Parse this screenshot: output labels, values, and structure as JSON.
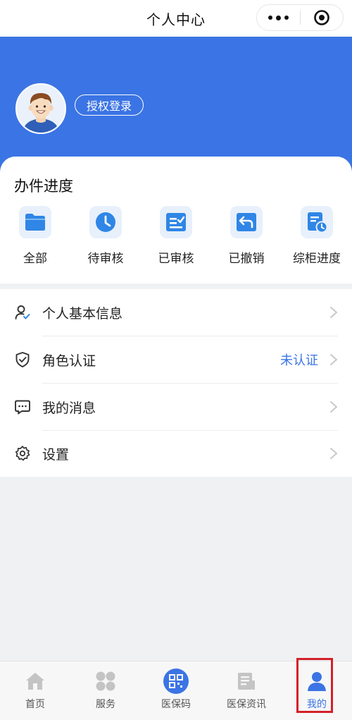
{
  "topbar": {
    "title": "个人中心"
  },
  "profile": {
    "login_label": "授权登录"
  },
  "progress": {
    "title": "办件进度",
    "items": [
      {
        "label": "全部",
        "icon": "folder-icon"
      },
      {
        "label": "待审核",
        "icon": "clock-icon"
      },
      {
        "label": "已审核",
        "icon": "checklist-icon"
      },
      {
        "label": "已撤销",
        "icon": "undo-icon"
      },
      {
        "label": "综柜进度",
        "icon": "document-clock-icon"
      }
    ]
  },
  "menu": {
    "items": [
      {
        "label": "个人基本信息",
        "icon": "user-check-icon",
        "value": ""
      },
      {
        "label": "角色认证",
        "icon": "shield-check-icon",
        "value": "未认证"
      },
      {
        "label": "我的消息",
        "icon": "message-icon",
        "value": ""
      },
      {
        "label": "设置",
        "icon": "gear-icon",
        "value": ""
      }
    ]
  },
  "tabbar": {
    "items": [
      {
        "label": "首页",
        "icon": "home-icon"
      },
      {
        "label": "服务",
        "icon": "grid-icon"
      },
      {
        "label": "医保码",
        "icon": "qr-code-icon"
      },
      {
        "label": "医保资讯",
        "icon": "news-icon"
      },
      {
        "label": "我的",
        "icon": "user-icon",
        "active": true
      }
    ]
  },
  "colors": {
    "brand": "#3b74e4",
    "icon_bg": "#e7f0fb",
    "highlight": "#d3202a",
    "inactive_tab": "#c4c4c4"
  }
}
